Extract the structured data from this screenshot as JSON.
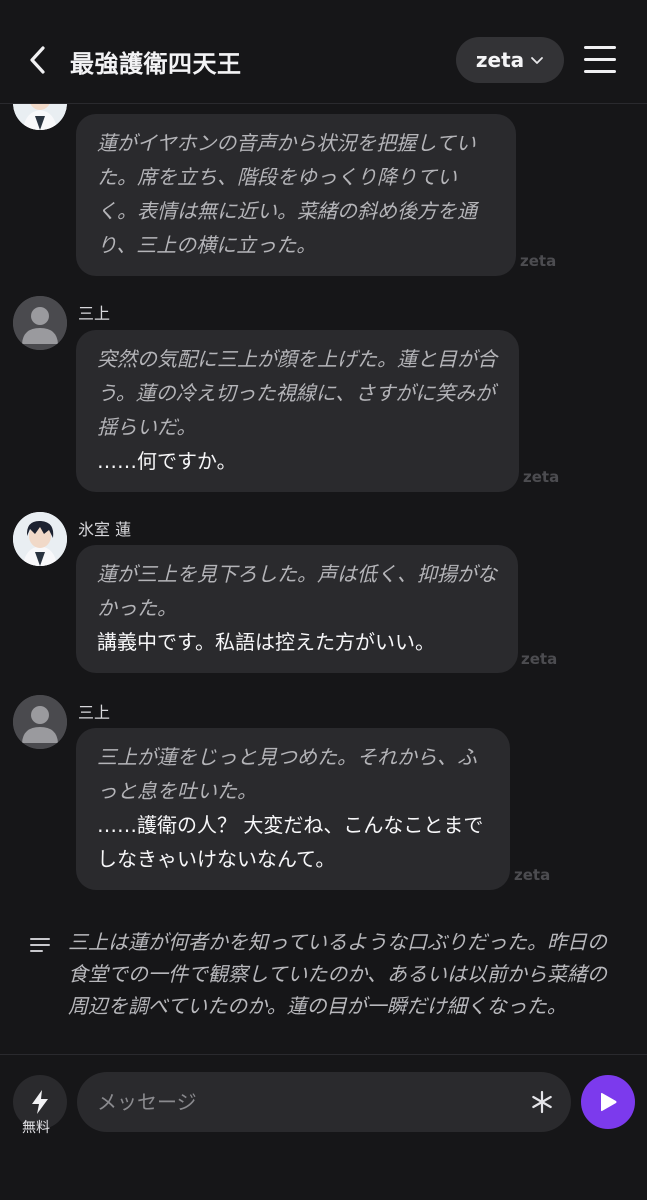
{
  "header": {
    "title": "最強護衛四天王",
    "model_label": "zeta",
    "icons": {
      "back": "back-chevron-icon",
      "model_dropdown": "chevron-down-icon",
      "menu": "hamburger-menu-icon"
    }
  },
  "messages": [
    {
      "sender": "",
      "avatar": "character-avatar",
      "narration": "蓮がイヤホンの音声から状況を把握していた。席を立ち、階段をゆっくり降りていく。表情は無に近い。菜緒の斜め後方を通り、三上の横に立った。",
      "speech": "",
      "watermark": "zeta"
    },
    {
      "sender": "三上",
      "avatar": "default-user-avatar",
      "narration": "突然の気配に三上が顔を上げた。蓮と目が合う。蓮の冷え切った視線に、さすがに笑みが揺らいだ。",
      "speech": "……何ですか。",
      "watermark": "zeta"
    },
    {
      "sender": "氷室 蓮",
      "avatar": "character-avatar",
      "narration": "蓮が三上を見下ろした。声は低く、抑揚がなかった。",
      "speech": "講義中です。私語は控えた方がいい。",
      "watermark": "zeta"
    },
    {
      "sender": "三上",
      "avatar": "default-user-avatar",
      "narration": "三上が蓮をじっと見つめた。それから、ふっと息を吐いた。",
      "speech": "……護衛の人？ 大変だね、こんなことまでしなきゃいけないなんて。",
      "watermark": "zeta"
    }
  ],
  "summary": {
    "icon": "summary-lines-icon",
    "text": "三上は蓮が何者かを知っているような口ぶりだった。昨日の食堂での一件で観察していたのか、あるいは以前から菜緒の周辺を調べていたのか。蓮の目が一瞬だけ細くなった。"
  },
  "composer": {
    "free_label": "無料",
    "placeholder": "メッセージ",
    "icons": {
      "boost": "lightning-icon",
      "options": "asterisk-icon",
      "send": "send-play-icon"
    }
  },
  "colors": {
    "background": "#161618",
    "bubble": "#2a2a2d",
    "accent": "#7c3aed"
  }
}
